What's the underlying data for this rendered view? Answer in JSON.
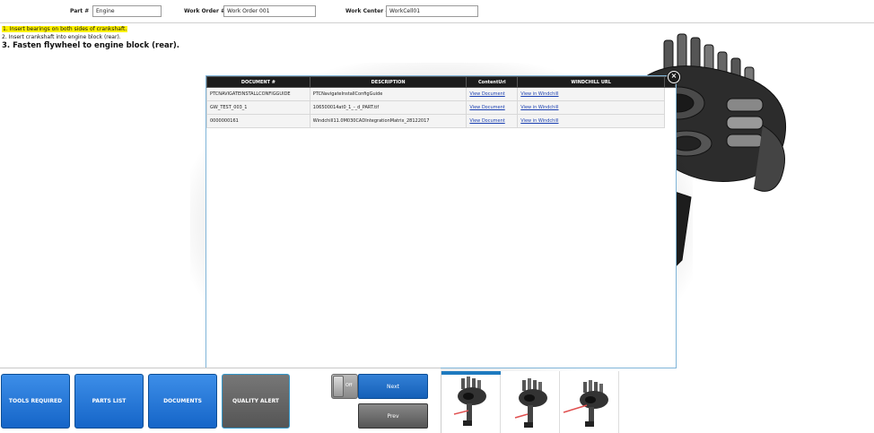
{
  "header": {
    "part_label": "Part #",
    "part_value": "Engine",
    "work_order_label": "Work Order #",
    "work_order_value": "Work Order 001",
    "work_center_label": "Work Center #",
    "work_center_value": "WorkCell01"
  },
  "instructions": [
    "1. Insert bearings on both sides of crankshaft.",
    "2. Insert crankshaft into engine block (rear).",
    "3. Fasten flywheel to engine block (rear)."
  ],
  "documents_modal": {
    "columns": [
      "DOCUMENT #",
      "DESCRIPTION",
      "ContentUrl",
      "WINDCHILL URL"
    ],
    "rows": [
      {
        "doc": "PTCNAVIGATEINSTALLCONFIGGUIDE",
        "desc": "PTCNavigateInstallConfigGuide",
        "content": "View Document",
        "windchill": "View in Windchill"
      },
      {
        "doc": "GW_TEST_003_1",
        "desc": "106500014at0_1_-_d_PART.tif",
        "content": "View Document",
        "windchill": "View in Windchill"
      },
      {
        "doc": "0000000161",
        "desc": "Windchill11.0M030CADIntegrationMatrix_28122017",
        "content": "View Document",
        "windchill": "View in Windchill"
      }
    ],
    "close_glyph": "×"
  },
  "toolbar": {
    "tools_required": "TOOLS REQUIRED",
    "parts_list": "PARTS LIST",
    "documents": "DOCUMENTS",
    "quality_alert": "QUALITY ALERT",
    "toggle_label": "Off",
    "next": "Next",
    "prev": "Prev"
  },
  "colors": {
    "accent_blue": "#1565c8",
    "highlight": "#fff200",
    "table_header": "#1c1c1c"
  }
}
